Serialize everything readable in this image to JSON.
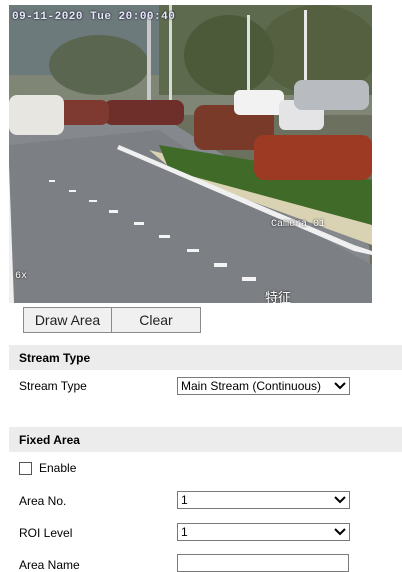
{
  "video": {
    "osd_date": "09-11-2020 Tue 20:00:40",
    "osd_camera": "Camera 01",
    "osd_zoom": "6x",
    "osd_overlay_text": "特征"
  },
  "buttons": {
    "draw_area": "Draw Area",
    "clear": "Clear"
  },
  "stream_type": {
    "section_title": "Stream Type",
    "label": "Stream Type",
    "value": "Main Stream (Continuous)"
  },
  "fixed_area": {
    "section_title": "Fixed Area",
    "enable_label": "Enable",
    "enable_checked": false,
    "area_no_label": "Area No.",
    "area_no_value": "1",
    "roi_level_label": "ROI Level",
    "roi_level_value": "1",
    "area_name_label": "Area Name",
    "area_name_value": ""
  }
}
